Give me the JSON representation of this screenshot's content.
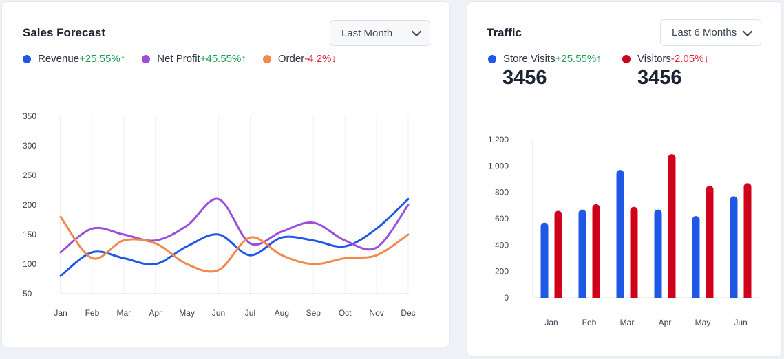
{
  "sales": {
    "title": "Sales Forecast",
    "period": "Last Month",
    "legend": [
      {
        "label": "Revenue",
        "change": "+25.55%",
        "arrow": "↑",
        "dir": "up",
        "color": "#1f57e6"
      },
      {
        "label": "Net Profit",
        "change": "+45.55%",
        "arrow": "↑",
        "dir": "up",
        "color": "#9b4fdc"
      },
      {
        "label": "Order",
        "change": "-4.2%",
        "arrow": "↓",
        "dir": "down",
        "color": "#f0894a"
      }
    ]
  },
  "traffic": {
    "title": "Traffic",
    "period": "Last 6 Months",
    "legend": [
      {
        "label": "Store Visits",
        "change": "+25.55%",
        "arrow": "↑",
        "dir": "up",
        "color": "#1f57e6",
        "value": "3456"
      },
      {
        "label": "Visitors",
        "change": "-2.05%",
        "arrow": "↓",
        "dir": "down",
        "color": "#d0021b",
        "value": "3456"
      }
    ]
  },
  "chart_data": [
    {
      "type": "line",
      "categories": [
        "Jan",
        "Feb",
        "Mar",
        "Apr",
        "May",
        "Jun",
        "Jul",
        "Aug",
        "Sep",
        "Oct",
        "Nov",
        "Dec"
      ],
      "ylim": [
        50,
        350
      ],
      "yticks": [
        "50",
        "100",
        "150",
        "200",
        "250",
        "300",
        "350"
      ],
      "grid": "vertical",
      "series": [
        {
          "name": "Revenue",
          "color": "#1f57e6",
          "values": [
            80,
            120,
            110,
            100,
            130,
            150,
            115,
            145,
            140,
            130,
            160,
            210
          ]
        },
        {
          "name": "Net Profit",
          "color": "#9b4fdc",
          "values": [
            120,
            160,
            150,
            140,
            165,
            210,
            135,
            155,
            170,
            140,
            128,
            200
          ]
        },
        {
          "name": "Order",
          "color": "#f0894a",
          "values": [
            180,
            110,
            140,
            135,
            100,
            90,
            145,
            115,
            100,
            110,
            115,
            150
          ]
        }
      ]
    },
    {
      "type": "bar",
      "categories": [
        "Jan",
        "Feb",
        "Mar",
        "Apr",
        "May",
        "Jun"
      ],
      "ylim": [
        0,
        1200
      ],
      "yticks": [
        "0",
        "200",
        "400",
        "600",
        "800",
        "1,000",
        "1,200"
      ],
      "series": [
        {
          "name": "Store Visits",
          "color": "#1f57e6",
          "values": [
            570,
            670,
            970,
            670,
            620,
            770
          ]
        },
        {
          "name": "Visitors",
          "color": "#d0021b",
          "values": [
            660,
            710,
            690,
            1090,
            850,
            870
          ]
        }
      ]
    }
  ]
}
